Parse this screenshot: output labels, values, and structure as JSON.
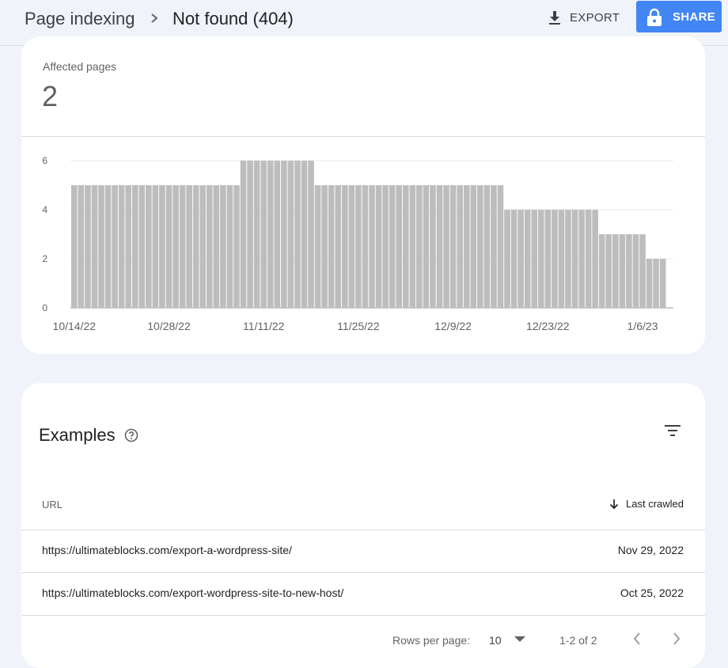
{
  "header": {
    "breadcrumb_parent": "Page indexing",
    "breadcrumb_current": "Not found (404)",
    "export_label": "EXPORT",
    "share_label": "SHARE"
  },
  "summary": {
    "label": "Affected pages",
    "value": "2"
  },
  "chart_data": {
    "type": "bar",
    "title": "",
    "xlabel": "",
    "ylabel": "",
    "ylim": [
      0,
      6
    ],
    "y_ticks": [
      0,
      2,
      4,
      6
    ],
    "grid": true,
    "x_tick_labels": [
      "10/14/22",
      "10/28/22",
      "11/11/22",
      "11/25/22",
      "12/9/22",
      "12/23/22",
      "1/6/23"
    ],
    "x_tick_bar_index": [
      0,
      14,
      28,
      42,
      56,
      70,
      84
    ],
    "color": "#bdbdbd",
    "values": [
      5,
      5,
      5,
      5,
      5,
      5,
      5,
      5,
      5,
      5,
      5,
      5,
      5,
      5,
      5,
      5,
      5,
      5,
      5,
      5,
      5,
      5,
      5,
      5,
      5,
      6,
      6,
      6,
      6,
      6,
      6,
      6,
      6,
      6,
      6,
      6,
      5,
      5,
      5,
      5,
      5,
      5,
      5,
      5,
      5,
      5,
      5,
      5,
      5,
      5,
      5,
      5,
      5,
      5,
      5,
      5,
      5,
      5,
      5,
      5,
      5,
      5,
      5,
      5,
      4,
      4,
      4,
      4,
      4,
      4,
      4,
      4,
      4,
      4,
      4,
      4,
      4,
      4,
      3,
      3,
      3,
      3,
      3,
      3,
      3,
      2,
      2,
      2
    ]
  },
  "examples": {
    "title": "Examples",
    "columns": {
      "url": "URL",
      "last_crawled": "Last crawled"
    },
    "rows": [
      {
        "url": "https://ultimateblocks.com/export-a-wordpress-site/",
        "date": "Nov 29, 2022"
      },
      {
        "url": "https://ultimateblocks.com/export-wordpress-site-to-new-host/",
        "date": "Oct 25, 2022"
      }
    ],
    "pagination": {
      "rows_per_page_label": "Rows per page:",
      "rows_per_page_value": "10",
      "range": "1-2 of 2"
    }
  },
  "icons": {
    "breadcrumb_separator": "chevron-right-icon",
    "export": "download-icon",
    "share": "lock-icon",
    "help": "help-circle-icon",
    "filter": "filter-icon",
    "sort": "arrow-down-icon",
    "pager_prev": "chevron-left-icon",
    "pager_next": "chevron-right-icon"
  }
}
